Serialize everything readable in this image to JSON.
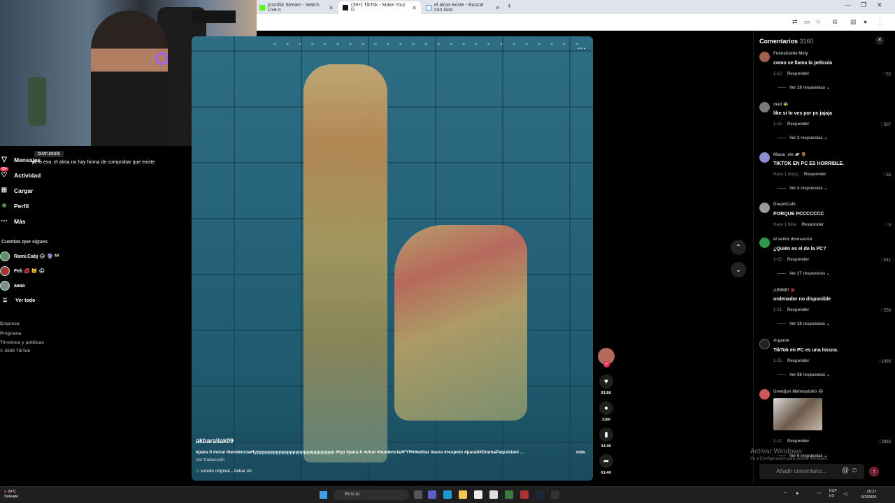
{
  "browser": {
    "tabs": [
      {
        "title": "josc0kk Stream - Watch Live o",
        "active": false
      },
      {
        "title": "(39+) TikTok - Make Your D",
        "active": true
      },
      {
        "title": "el alma existe - Buscar con Goo",
        "active": false
      }
    ]
  },
  "chat": {
    "username": "bistrustobi",
    "message": "pero eso, el alma no hay forma de comprobar que existe"
  },
  "sidebar": {
    "items": [
      {
        "label": "Mensajes",
        "icon": "message-icon",
        "badge": "99+"
      },
      {
        "label": "Actividad",
        "icon": "activity-icon",
        "badge": "99+"
      },
      {
        "label": "Cargar",
        "icon": "upload-icon"
      },
      {
        "label": "Perfil",
        "icon": "profile-icon"
      },
      {
        "label": "Más",
        "icon": "more-icon"
      }
    ],
    "following_title": "Cuentas que sigues",
    "following": [
      "Rami.Cabj 🌧 🔮 ᴬᴿ",
      "Feli 💋 🐱 🌧",
      "aaaa"
    ],
    "see_all": "Ver todo",
    "footer": [
      "Empresa",
      "Programa",
      "Términos y políticas",
      "© 2026 TikTok"
    ]
  },
  "video": {
    "author": "akbaraliak09",
    "caption": "#para ti #viral #tendencia#fypppppppppppppppppppppppppppp #fyp #para ti #viral #tendencia#FYP##editar #aura #respeto #parati#DramaPaquistani ...",
    "more": "más",
    "translate": "Ver traducción",
    "sound": "sonido original - Akbar Ali"
  },
  "actions": {
    "likes": "91.8K",
    "comments": "3160",
    "saves": "14.4K",
    "shares": "61.4K"
  },
  "comments_panel": {
    "title": "Comentarios",
    "count": "3160",
    "input_placeholder": "Añadir comentario...",
    "comments": [
      {
        "user": "Fuenalcalde Mely",
        "text": "como se llama la película",
        "date": "1-12",
        "reply": "Responder",
        "likes": "52",
        "replies": "Ver 19 respuestas"
      },
      {
        "user": "mati 🐝",
        "text": "like si lo ves por pc jajaja",
        "date": "1-15",
        "reply": "Responder",
        "likes": "307",
        "replies": "Ver 2 respuestas"
      },
      {
        "user": "Miauu_ele 🪐 🌻",
        "text": "TIKTOK EN PC ES HORRIBLE.",
        "date": "Hace 1 día(s)",
        "reply": "Responder",
        "likes": "56",
        "replies": "Ver 4 respuestas"
      },
      {
        "user": "DreamCafé",
        "text": "PORQUE PCCCCCCC",
        "date": "Hace 1 hora",
        "reply": "Responder",
        "likes": "0",
        "replies": ""
      },
      {
        "user": "el señor dinosaurio",
        "text": "¿Quién es el de la PC?",
        "date": "1-15",
        "reply": "Responder",
        "likes": "511",
        "replies": "Ver 27 respuestas"
      },
      {
        "user": "¡UNNIE! 🐞",
        "text": "ordenador no disponible",
        "date": "1-21",
        "reply": "Responder",
        "likes": "556",
        "replies": "Ver 18 respuestas"
      },
      {
        "user": "Argente",
        "text": "TikTok en PC es una locura.",
        "date": "1-25",
        "reply": "Responder",
        "likes": "1893",
        "replies": "Ver 58 respuestas"
      },
      {
        "user": "Umedjon Mahmadullo 🌧",
        "text": "",
        "date": "1-12",
        "reply": "Responder",
        "likes": "2983",
        "replies": "Ver 6 respuestas"
      }
    ]
  },
  "windows_watermark": {
    "title": "Activar Windows",
    "subtitle": "Ve a Configuración para activar Windows."
  },
  "taskbar": {
    "weather_temp": "30°C",
    "weather_text": "Soleado",
    "search": "Buscar",
    "lang": "ESP",
    "lang_sub": "ES",
    "time": "20:17",
    "date": "5/2/2026"
  }
}
